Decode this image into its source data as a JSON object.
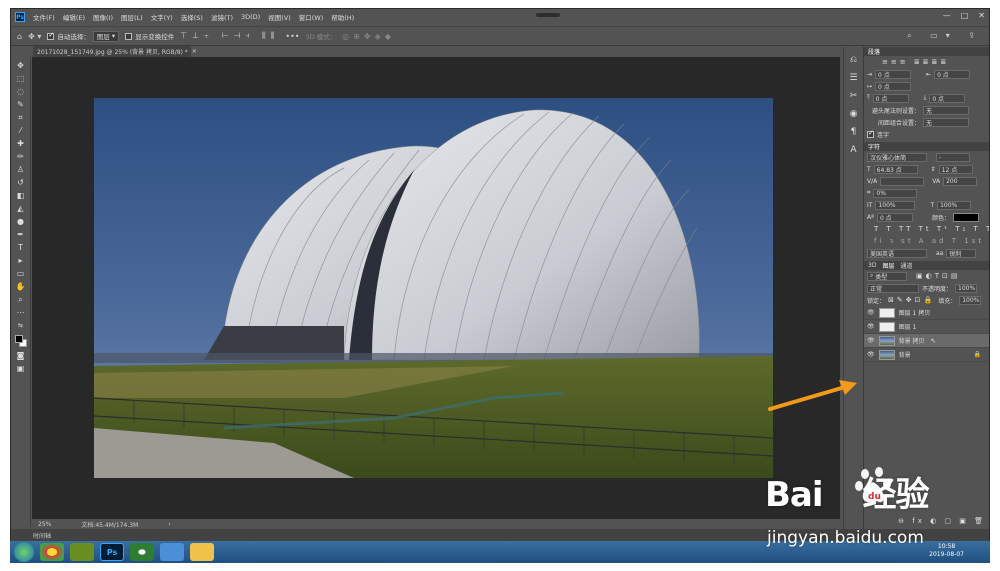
{
  "app": {
    "logo": "Ps"
  },
  "menu": [
    "文件(F)",
    "编辑(E)",
    "图像(I)",
    "图层(L)",
    "文字(Y)",
    "选择(S)",
    "滤镜(T)",
    "3D(D)",
    "视图(V)",
    "窗口(W)",
    "帮助(H)"
  ],
  "window_controls": [
    "—",
    "□",
    "✕"
  ],
  "options": {
    "auto_select_label": "自动选择：",
    "auto_select_value": "图层",
    "show_transform_label": "显示变换控件",
    "mode3d_label": "3D 模式："
  },
  "document": {
    "tab_title": "20171028_151749.jpg @ 25% (背景 拷贝, RGB/8) *"
  },
  "status": {
    "zoom": "25%",
    "doc_size": "文档:45.4M/174.3M"
  },
  "timeline": {
    "label": "时间轴"
  },
  "paragraph_panel": {
    "title": "段落",
    "indent_left": "0 点",
    "indent_right": "0 点",
    "indent_first": "0 点",
    "space_before": "0 点",
    "space_after": "0 点",
    "avoid_label": "避头尾法则设置：",
    "avoid_value": "无",
    "spacing_label": "间距组合设置：",
    "spacing_value": "无",
    "hyphen_label": "连字"
  },
  "character_panel": {
    "title": "字符",
    "font_family": "汉仪雅心体简",
    "font_style": "-",
    "font_size": "64.83 点",
    "leading": "12 点",
    "kerning": "V/A",
    "tracking": "200",
    "scale_percent": "0%",
    "vscale": "100%",
    "hscale": "100%",
    "baseline": "0 点",
    "color_label": "颜色：",
    "color_value": "#000000",
    "language": "美国英语",
    "antialias": "锐利"
  },
  "layers_panel": {
    "tabs": [
      "3D",
      "图层",
      "通道"
    ],
    "active_tab": "图层",
    "filter_label": "类型",
    "blend_mode": "正常",
    "opacity_label": "不透明度：",
    "opacity": "100%",
    "lock_label": "锁定：",
    "fill_label": "填充：",
    "fill": "100%",
    "layers": [
      {
        "name": "图层 1 拷贝",
        "thumb": "white",
        "selected": false
      },
      {
        "name": "图层 1",
        "thumb": "white",
        "selected": false
      },
      {
        "name": "背景 拷贝",
        "thumb": "photo",
        "selected": true
      },
      {
        "name": "背景",
        "thumb": "photo",
        "selected": false
      }
    ]
  },
  "taskbar": {
    "time": "10:58",
    "date": "2019-08-07",
    "apps": [
      "chrome-icon",
      "minecraft-icon",
      "photoshop-icon",
      "360-icon",
      "network-icon",
      "folder-icon"
    ]
  },
  "watermark": {
    "brand": "Bai",
    "brand_cn": "经验",
    "url": "jingyan.baidu.com"
  },
  "colors": {
    "accent_arrow": "#f39a1a",
    "ps_blue": "#31a8ff"
  }
}
